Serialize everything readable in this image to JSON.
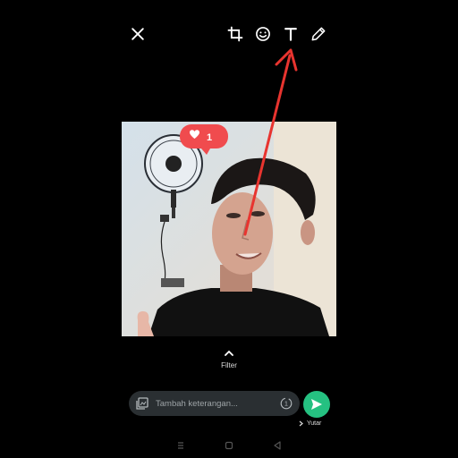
{
  "toolbar": {
    "close_icon": "close-icon",
    "crop_icon": "crop-rotate-icon",
    "emoji_icon": "emoji-icon",
    "text_icon": "text-icon",
    "pencil_icon": "pencil-icon"
  },
  "photo": {
    "like_count": "1"
  },
  "filter": {
    "label": "Filter"
  },
  "caption": {
    "placeholder": "Tambah keterangan...",
    "timer_badge": "1"
  },
  "recipient": {
    "name": "Yutar"
  },
  "colors": {
    "accent": "#25c181",
    "arrow": "#e8342f",
    "badge": "#f04b4e"
  }
}
